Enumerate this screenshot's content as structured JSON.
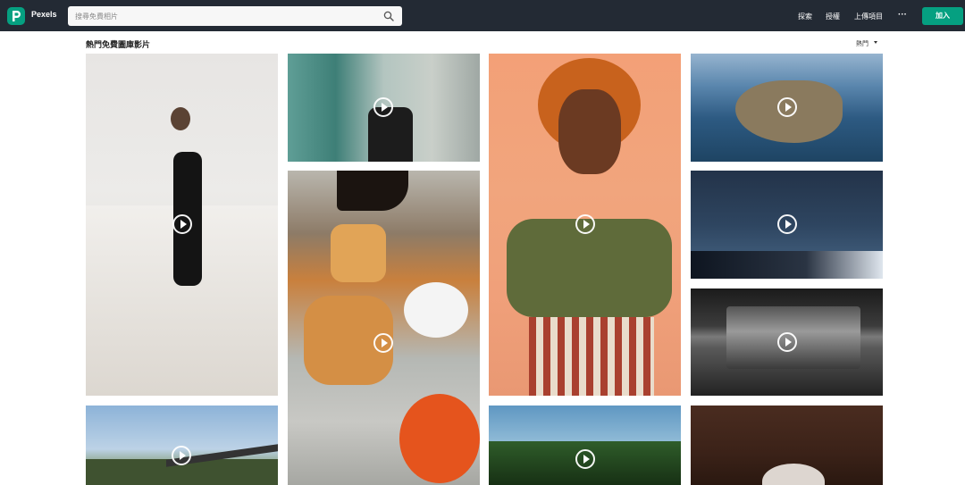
{
  "header": {
    "brand": "Pexels",
    "search_placeholder": "搜尋免費相片",
    "nav": [
      "探索",
      "授權",
      "上傳項目"
    ],
    "more_label": "···",
    "join_label": "加入"
  },
  "section": {
    "title": "熱門免費圖庫影片",
    "sort_label": "熱門"
  },
  "colors": {
    "accent": "#05a081",
    "header_bg": "#232a34"
  },
  "tiles": [
    {
      "icon": "play-icon"
    },
    {
      "icon": "play-icon"
    },
    {
      "icon": "play-icon"
    },
    {
      "icon": "play-icon"
    },
    {
      "icon": "play-icon"
    },
    {
      "icon": "play-icon"
    },
    {
      "icon": "play-icon"
    },
    {
      "icon": "play-icon"
    },
    {
      "icon": "play-icon"
    },
    {
      "icon": "play-icon"
    }
  ]
}
